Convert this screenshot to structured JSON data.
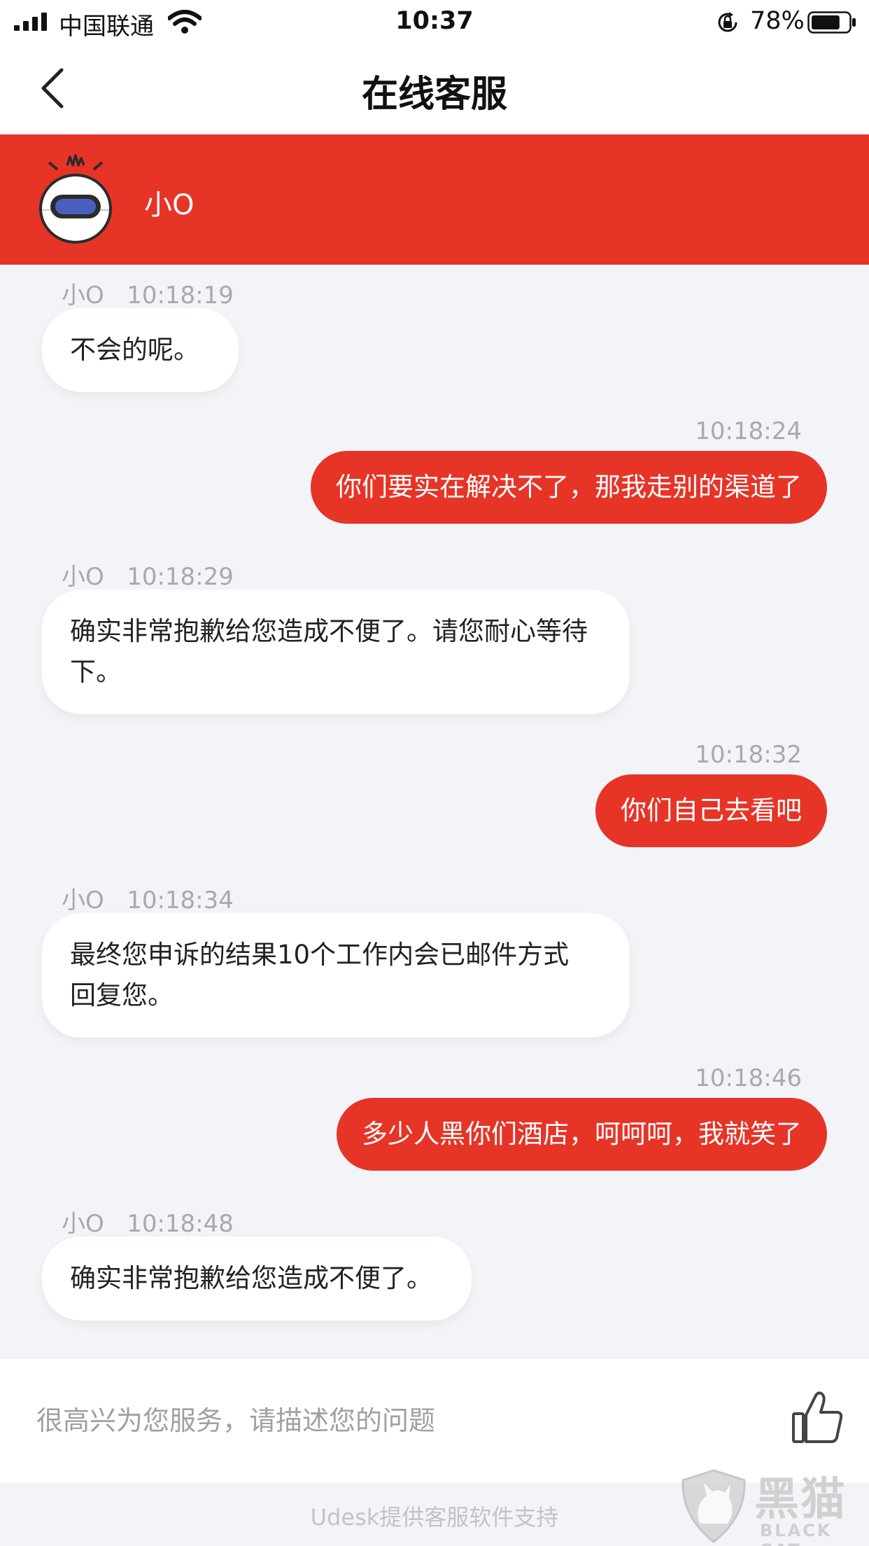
{
  "status_bar": {
    "carrier": "中国联通",
    "time": "10:37",
    "battery_percent": "78%",
    "battery_level": 0.78,
    "icons": [
      "signal-icon",
      "wifi-icon",
      "rotation-lock-icon",
      "battery-icon"
    ]
  },
  "nav": {
    "title": "在线客服",
    "back_icon": "chevron-left-icon"
  },
  "agent": {
    "name": "小O",
    "avatar_icon": "robot-avatar-icon"
  },
  "messages": [
    {
      "side": "agent",
      "sender": "小O",
      "time": "10:18:19",
      "text": "不会的呢。"
    },
    {
      "side": "user",
      "time": "10:18:24",
      "text": "你们要实在解决不了，那我走别的渠道了"
    },
    {
      "side": "agent",
      "sender": "小O",
      "time": "10:18:29",
      "text": "确实非常抱歉给您造成不便了。请您耐心等待下。"
    },
    {
      "side": "user",
      "time": "10:18:32",
      "text": "你们自己去看吧"
    },
    {
      "side": "agent",
      "sender": "小O",
      "time": "10:18:34",
      "text": "最终您申诉的结果10个工作内会已邮件方式回复您。"
    },
    {
      "side": "user",
      "time": "10:18:46",
      "text": "多少人黑你们酒店，呵呵呵，我就笑了"
    },
    {
      "side": "agent",
      "sender": "小O",
      "time": "10:18:48",
      "text": "确实非常抱歉给您造成不便了。"
    }
  ],
  "input": {
    "placeholder": "很高兴为您服务，请描述您的问题",
    "value": "",
    "thumb_icon": "thumbs-up-icon"
  },
  "footer": {
    "powered_by": "Udesk提供客服软件支持"
  },
  "watermark": {
    "text_cn": "黑猫",
    "text_en": "BLACK CAT"
  },
  "colors": {
    "accent": "#e63427",
    "chat_background": "#f3f4f7",
    "meta_text": "#a9a9ad"
  }
}
